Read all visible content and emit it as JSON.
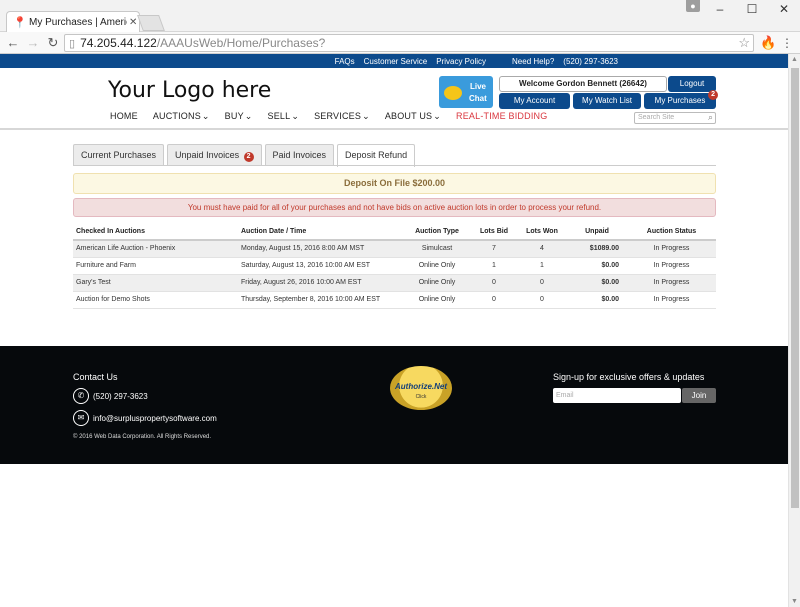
{
  "browser": {
    "tab_title": "My Purchases | American",
    "url_host": "74.205.44.122",
    "url_path": "/AAAUsWeb/Home/Purchases?"
  },
  "colors": {
    "brand_blue": "#0c4a8c",
    "alert_red": "#c0392b",
    "rtb_red": "#d9363e",
    "footer_bg": "#06090c"
  },
  "topbar": {
    "faqs": "FAQs",
    "customer_service": "Customer Service",
    "privacy_policy": "Privacy Policy",
    "need_help": "Need Help?",
    "phone": "(520) 297-3623"
  },
  "header": {
    "logo": "Your Logo here",
    "live_chat_1": "Live",
    "live_chat_2": "Chat",
    "welcome": "Welcome Gordon Bennett (26642)",
    "logout": "Logout",
    "my_account": "My Account",
    "my_watch_list": "My Watch List",
    "my_purchases": "My Purchases",
    "purchases_badge": "2"
  },
  "nav": {
    "home": "HOME",
    "auctions": "AUCTIONS",
    "buy": "BUY",
    "sell": "SELL",
    "services": "SERVICES",
    "about_us": "ABOUT US",
    "rtb": "REAL-TIME BIDDING",
    "search_placeholder": "Search Site"
  },
  "tabs": {
    "current": "Current Purchases",
    "unpaid": "Unpaid Invoices",
    "unpaid_badge": "2",
    "paid": "Paid Invoices",
    "deposit": "Deposit Refund"
  },
  "deposit_text": "Deposit On File $200.00",
  "alert_text": "You must have paid for all of your purchases and not have bids on active auction lots in order to process your refund.",
  "table": {
    "headers": [
      "Checked In Auctions",
      "Auction Date / Time",
      "Auction Type",
      "Lots Bid",
      "Lots Won",
      "Unpaid",
      "Auction Status"
    ],
    "rows": [
      [
        "American Life Auction - Phoenix",
        "Monday, August 15, 2016 8:00 AM MST",
        "Simulcast",
        "7",
        "4",
        "$1089.00",
        "In Progress"
      ],
      [
        "Furniture and Farm",
        "Saturday, August 13, 2016 10:00 AM EST",
        "Online Only",
        "1",
        "1",
        "$0.00",
        "In Progress"
      ],
      [
        "Gary's Test",
        "Friday, August 26, 2016 10:00 AM EST",
        "Online Only",
        "0",
        "0",
        "$0.00",
        "In Progress"
      ],
      [
        "Auction for Demo Shots",
        "Thursday, September 8, 2016 10:00 AM EST",
        "Online Only",
        "0",
        "0",
        "$0.00",
        "In Progress"
      ]
    ]
  },
  "footer": {
    "contact": "Contact Us",
    "phone": "(520) 297-3623",
    "email": "info@surpluspropertysoftware.com",
    "copyright": "© 2016 Web Data Corporation. All Rights Reserved.",
    "seal_text": "Authorize.Net",
    "seal_click": "Click",
    "signup": "Sign-up for exclusive offers & updates",
    "email_placeholder": "Email",
    "join": "Join"
  }
}
